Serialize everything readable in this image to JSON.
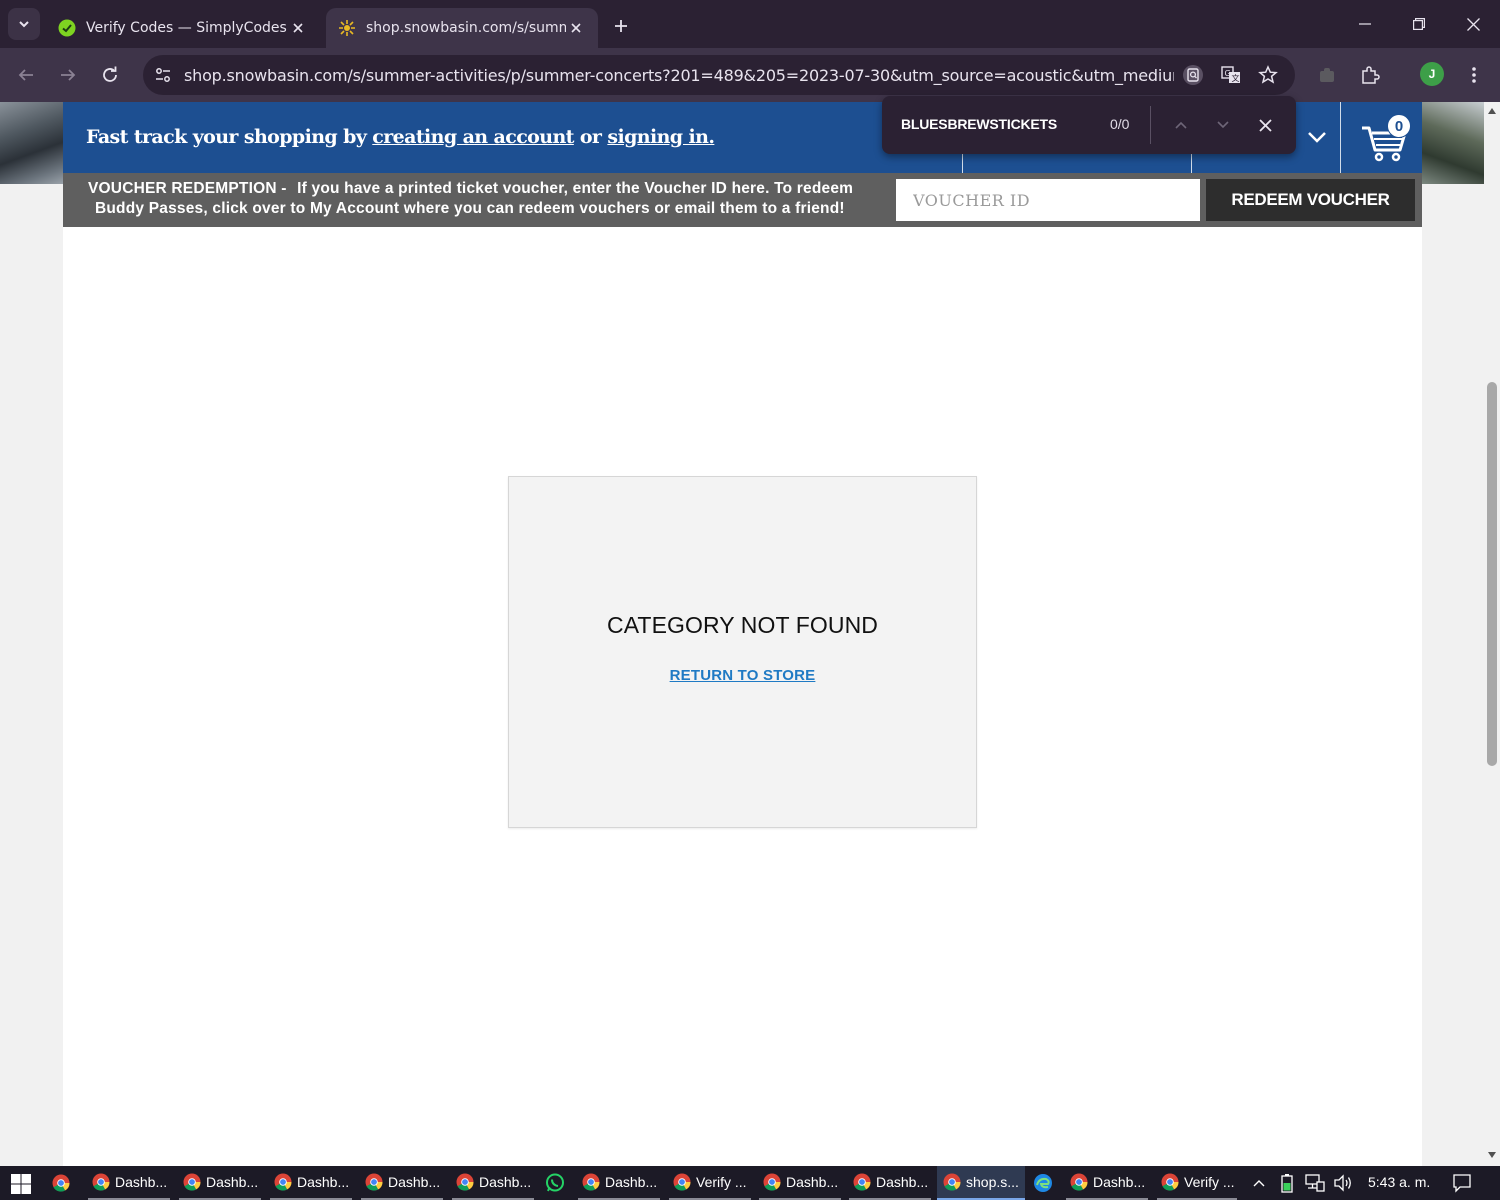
{
  "browser": {
    "tabs": [
      {
        "title": "Verify Codes — SimplyCodes",
        "active": false
      },
      {
        "title": "shop.snowbasin.com/s/summer-activities",
        "active": true
      }
    ],
    "url": "shop.snowbasin.com/s/summer-activities/p/summer-concerts?201=489&205=2023-07-30&utm_source=acoustic&utm_medium=ema...",
    "profile_initial": "J"
  },
  "find_bar": {
    "query": "BLUESBREWSTICKETS",
    "count": "0/0"
  },
  "page": {
    "banner": {
      "prefix": "Fast track your shopping by",
      "create_link": "creating an account",
      "middle": "or",
      "signin_link": "signing in."
    },
    "cart": {
      "count": "0"
    },
    "voucher": {
      "label": "VOUCHER REDEMPTION -",
      "line1": "If you have a printed ticket voucher, enter the Voucher ID here. To redeem",
      "line2": "Buddy Passes, click over to My Account where you can redeem vouchers or email them to a friend!",
      "placeholder": "VOUCHER ID",
      "button": "REDEEM VOUCHER"
    },
    "not_found": {
      "title": "CATEGORY NOT FOUND",
      "link": "RETURN TO STORE"
    }
  },
  "taskbar": {
    "items": [
      {
        "label": "Dashb..."
      },
      {
        "label": "Dashb..."
      },
      {
        "label": "Dashb..."
      },
      {
        "label": "Dashb..."
      },
      {
        "label": "Dashb..."
      },
      {
        "label": "Dashb..."
      },
      {
        "label": "Verify ..."
      },
      {
        "label": "Dashb..."
      },
      {
        "label": "Dashb..."
      },
      {
        "label": "shop.s..."
      },
      {
        "label": "Dashb..."
      },
      {
        "label": "Verify ..."
      }
    ],
    "clock": "5:43 a. m."
  },
  "colors": {
    "banner_blue": "#1d4f91",
    "voucher_gray": "#5f5f5f",
    "link_blue": "#1f7ac4",
    "chrome_dark": "#2b2133"
  }
}
